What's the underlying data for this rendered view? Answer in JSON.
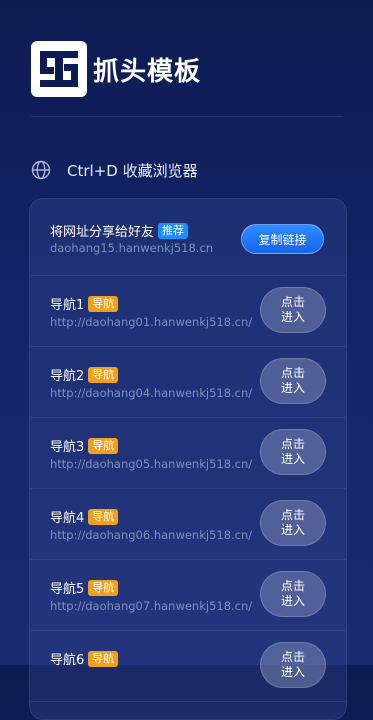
{
  "header": {
    "brand": "抓头模板",
    "logo_icon": "logo-icon"
  },
  "bookmark": {
    "icon": "globe-icon",
    "text": "Ctrl+D 收藏浏览器"
  },
  "share": {
    "title": "将网址分享给好友",
    "badge": "推荐",
    "url": "daohang15.hanwenkj518.cn",
    "button": "复制链接"
  },
  "nav_items": [
    {
      "title": "导航1",
      "badge": "导航",
      "url": "http://daohang01.hanwenkj518.cn/",
      "button": "点击进入"
    },
    {
      "title": "导航2",
      "badge": "导航",
      "url": "http://daohang04.hanwenkj518.cn/",
      "button": "点击进入"
    },
    {
      "title": "导航3",
      "badge": "导航",
      "url": "http://daohang05.hanwenkj518.cn/",
      "button": "点击进入"
    },
    {
      "title": "导航4",
      "badge": "导航",
      "url": "http://daohang06.hanwenkj518.cn/",
      "button": "点击进入"
    },
    {
      "title": "导航5",
      "badge": "导航",
      "url": "http://daohang07.hanwenkj518.cn/",
      "button": "点击进入"
    },
    {
      "title": "导航6",
      "badge": "导航",
      "url": "",
      "button": "点击进入"
    }
  ],
  "colors": {
    "accent_blue": "#1a8fff",
    "badge_orange": "#f1a01e",
    "background": "#13256a"
  }
}
